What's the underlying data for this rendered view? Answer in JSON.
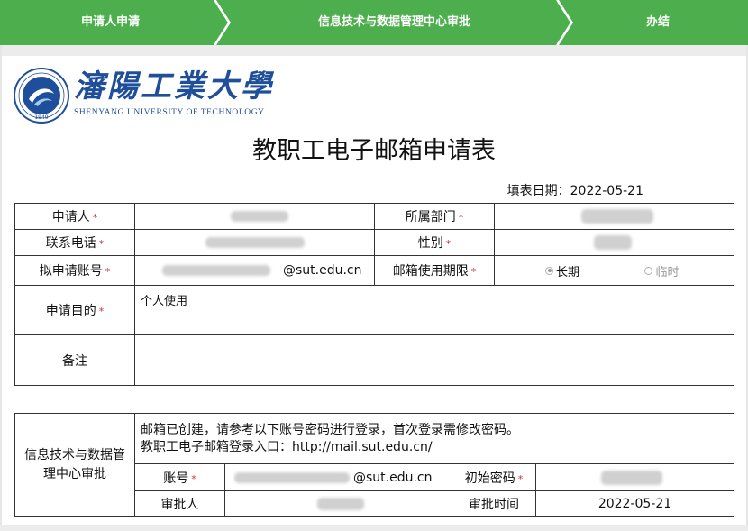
{
  "steps": {
    "items": [
      "申请人申请",
      "信息技术与数据管理中心审批",
      "办结"
    ],
    "color": "#4cae4c"
  },
  "logo": {
    "cn_name": "瀋陽工業大學",
    "en_name": "SHENYANG UNIVERSITY OF TECHNOLOGY",
    "seal_year": "1949"
  },
  "form": {
    "title": "教职工电子邮箱申请表",
    "fill_date_label": "填表日期：",
    "fill_date": "2022-05-21",
    "required_mark": "*",
    "applicant_label": "申请人",
    "department_label": "所属部门",
    "phone_label": "联系电话",
    "gender_label": "性别",
    "account_label": "拟申请账号",
    "account_domain": "@sut.edu.cn",
    "term_label": "邮箱使用期限",
    "term_options": [
      "长期",
      "临时"
    ],
    "term_selected": "长期",
    "purpose_label": "申请目的",
    "purpose_value": "个人使用",
    "remark_label": "备注"
  },
  "approval": {
    "section_label": "信息技术与数据管理中心审批",
    "note_line1": "邮箱已创建，请参考以下账号密码进行登录，首次登录需修改密码。",
    "note_line2": "教职工电子邮箱登录入口：http://mail.sut.edu.cn/",
    "account_label": "账号",
    "account_domain": "@sut.edu.cn",
    "init_password_label": "初始密码",
    "approver_label": "审批人",
    "approve_time_label": "审批时间",
    "approve_time": "2022-05-21"
  }
}
